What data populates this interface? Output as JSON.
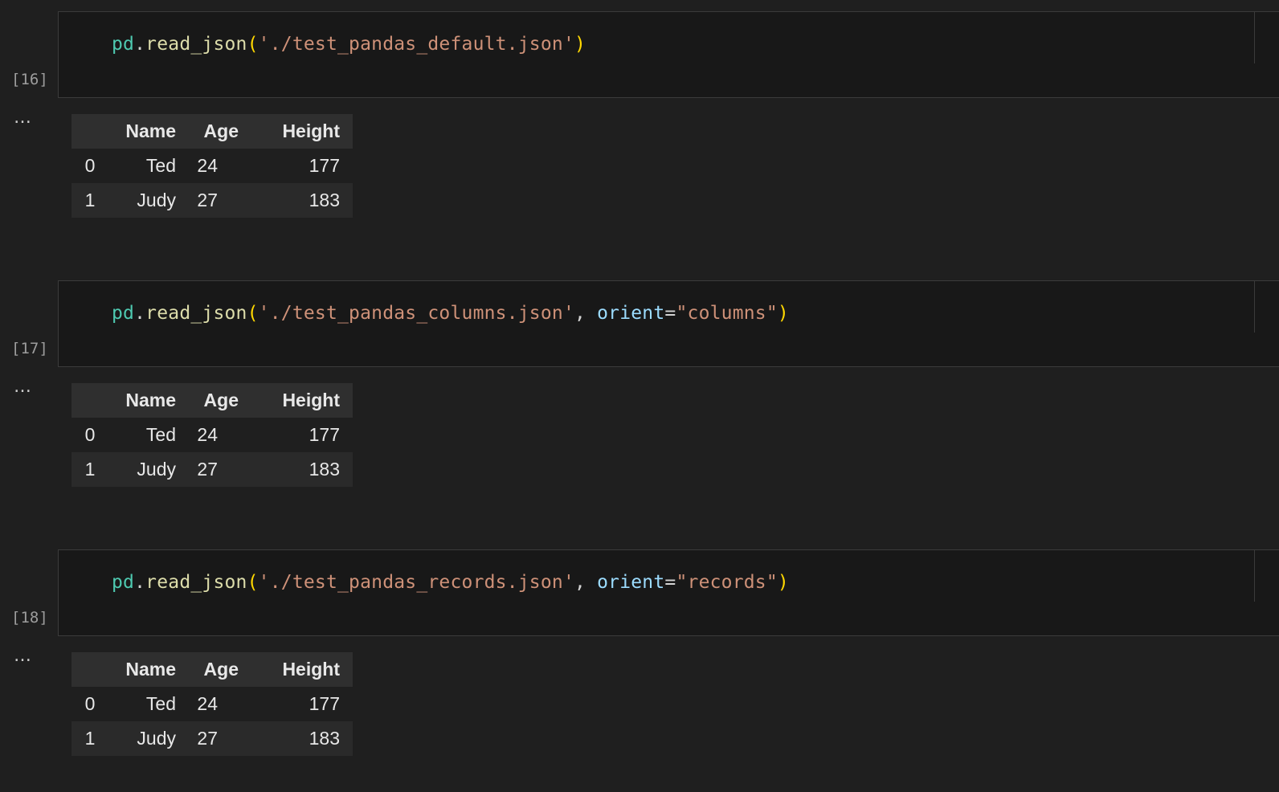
{
  "cells": [
    {
      "execution_count": "[16]",
      "output_prompt": "…",
      "code": {
        "module": "pd",
        "dot": ".",
        "function": "read_json",
        "open_paren": "(",
        "path_arg": "'./test_pandas_default.json'",
        "comma": "",
        "kwarg_name": "",
        "equals": "",
        "kwarg_value": "",
        "close_paren": ")"
      },
      "table": {
        "columns": [
          "",
          "Name",
          "Age",
          "Height"
        ],
        "rows": [
          {
            "index": "0",
            "Name": "Ted",
            "Age": "24",
            "Height": "177"
          },
          {
            "index": "1",
            "Name": "Judy",
            "Age": "27",
            "Height": "183"
          }
        ]
      }
    },
    {
      "execution_count": "[17]",
      "output_prompt": "…",
      "code": {
        "module": "pd",
        "dot": ".",
        "function": "read_json",
        "open_paren": "(",
        "path_arg": "'./test_pandas_columns.json'",
        "comma": ", ",
        "kwarg_name": "orient",
        "equals": "=",
        "kwarg_value": "\"columns\"",
        "close_paren": ")"
      },
      "table": {
        "columns": [
          "",
          "Name",
          "Age",
          "Height"
        ],
        "rows": [
          {
            "index": "0",
            "Name": "Ted",
            "Age": "24",
            "Height": "177"
          },
          {
            "index": "1",
            "Name": "Judy",
            "Age": "27",
            "Height": "183"
          }
        ]
      }
    },
    {
      "execution_count": "[18]",
      "output_prompt": "…",
      "code": {
        "module": "pd",
        "dot": ".",
        "function": "read_json",
        "open_paren": "(",
        "path_arg": "'./test_pandas_records.json'",
        "comma": ", ",
        "kwarg_name": "orient",
        "equals": "=",
        "kwarg_value": "\"records\"",
        "close_paren": ")"
      },
      "table": {
        "columns": [
          "",
          "Name",
          "Age",
          "Height"
        ],
        "rows": [
          {
            "index": "0",
            "Name": "Ted",
            "Age": "24",
            "Height": "177"
          },
          {
            "index": "1",
            "Name": "Judy",
            "Age": "27",
            "Height": "183"
          }
        ]
      }
    }
  ],
  "colors": {
    "background": "#1f1f1f",
    "cell_background": "#181818",
    "module": "#4ec9b0",
    "function": "#dcdcaa",
    "paren": "#ffd700",
    "string": "#ce9178",
    "keyword_arg": "#9cdcfe"
  }
}
